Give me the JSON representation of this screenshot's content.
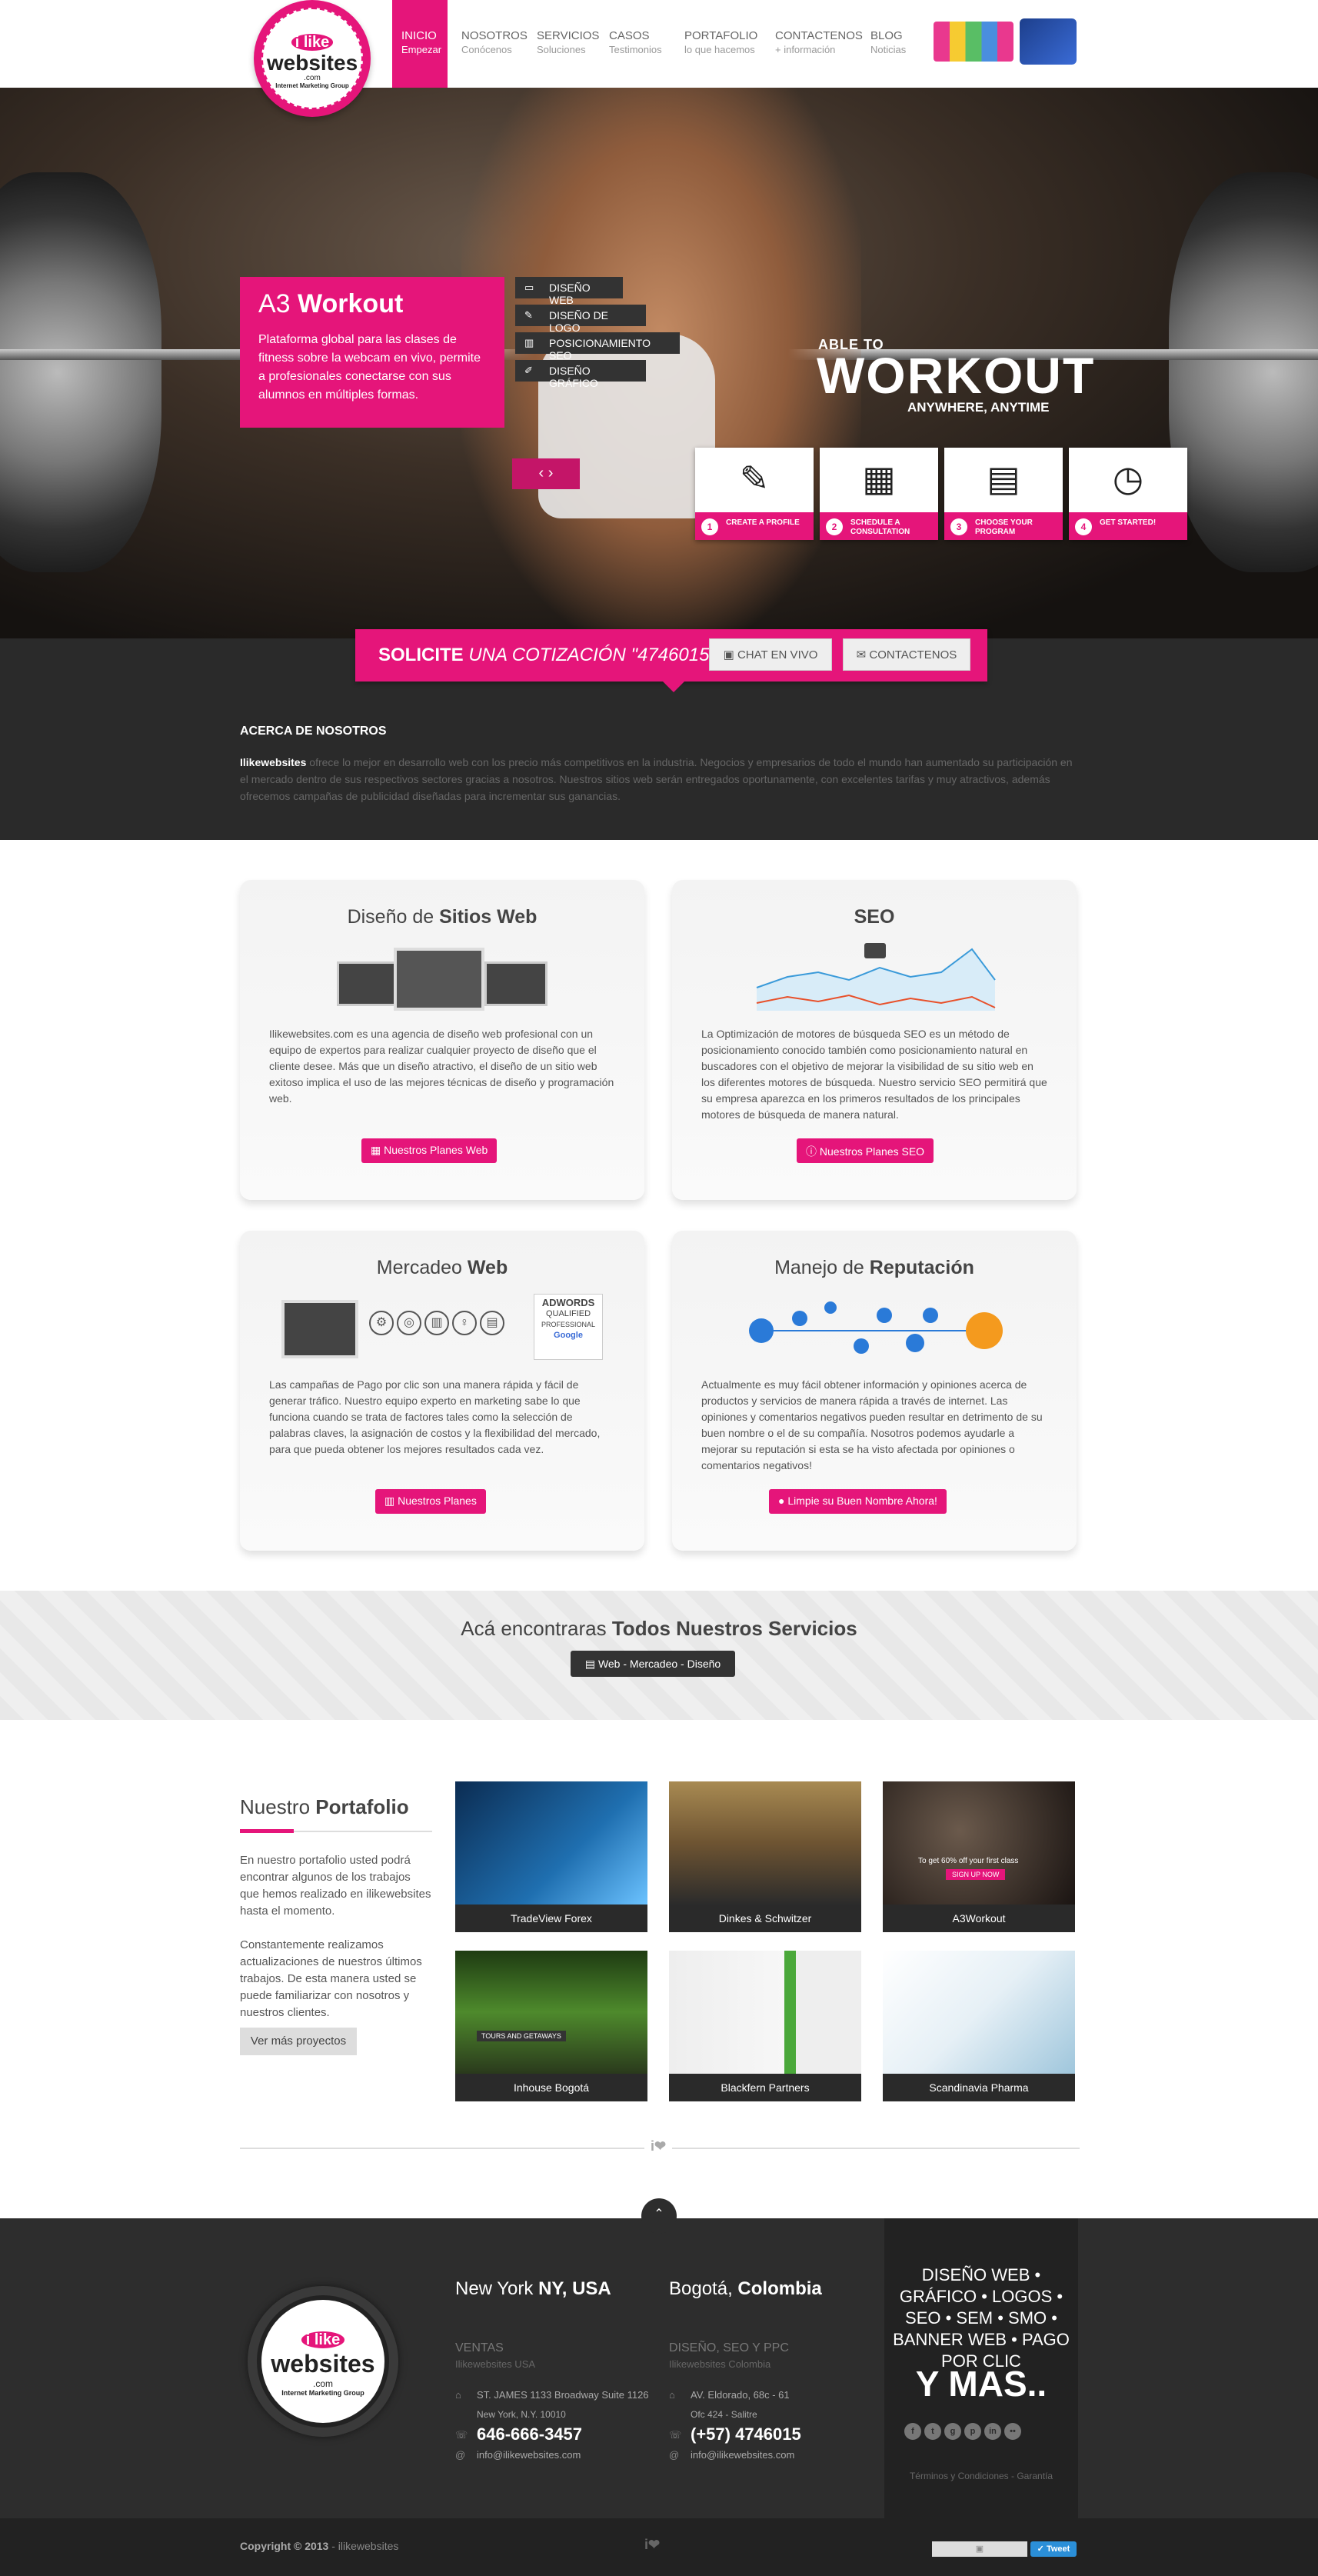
{
  "brand": {
    "logo_top": "i like",
    "logo_main": "websites",
    "logo_com": ".com",
    "logo_tag": "Internet Marketing Group",
    "accent": "#e5157a"
  },
  "nav": [
    {
      "label": "INICIO",
      "sub": "Empezar"
    },
    {
      "label": "NOSOTROS",
      "sub": "Conócenos"
    },
    {
      "label": "SERVICIOS",
      "sub": "Soluciones"
    },
    {
      "label": "CASOS",
      "sub": "Testimonios"
    },
    {
      "label": "PORTAFOLIO",
      "sub": "lo que hacemos"
    },
    {
      "label": "CONTACTENOS",
      "sub": "+ información"
    },
    {
      "label": "BLOG",
      "sub": "Noticias"
    }
  ],
  "hero": {
    "project_prefix": "A3",
    "project_name": "Workout",
    "project_desc": "Plataforma global para las clases de fitness sobre la webcam en vivo, permite a profesionales conectarse con sus alumnos en múltiples formas.",
    "tags": [
      "DISEÑO WEB",
      "DISEÑO DE LOGO",
      "POSICIONAMIENTO SEO",
      "DISEÑO GRÁFICO"
    ],
    "wo_line1": "ABLE TO",
    "wo_line2": "WORKOUT",
    "wo_line3": "ANYWHERE, ANYTIME",
    "steps": [
      {
        "num": "1",
        "label": "CREATE A PROFILE",
        "icon": "edit-icon"
      },
      {
        "num": "2",
        "label": "SCHEDULE A CONSULTATION",
        "icon": "calendar-icon"
      },
      {
        "num": "3",
        "label": "CHOOSE YOUR PROGRAM",
        "icon": "clipboard-icon"
      },
      {
        "num": "4",
        "label": "GET STARTED!",
        "icon": "stopwatch-icon"
      }
    ]
  },
  "quote": {
    "solicite": "SOLICITE",
    "rest": "UNA COTIZACIÓN \"4746015\"",
    "chat": "CHAT EN VIVO",
    "contact": "CONTACTENOS"
  },
  "about": {
    "title": "ACERCA DE NOSOTROS",
    "brand": "Ilikewebsites",
    "body": " ofrece lo mejor en desarrollo web con los precio más competitivos en la industria. Negocios y empresarios de todo el mundo han aumentado su participación en el mercado dentro de sus respectivos sectores gracias a nosotros. Nuestros sitios web serán entregados oportunamente, con excelentes tarifas y muy atractivos, además ofrecemos campañas de publicidad diseñadas para incrementar sus ganancias."
  },
  "services": [
    {
      "t1": "Diseño de",
      "t2": "Sitios Web",
      "body": "Ilikewebsites.com es una agencia de diseño web profesional con un equipo de expertos para realizar cualquier proyecto de diseño que el cliente desee. Más que un diseño atractivo, el diseño de un sitio web exitoso implica el uso de las mejores técnicas de diseño y programación web.",
      "btn": "Nuestros Planes Web"
    },
    {
      "t1": "",
      "t2": "SEO",
      "body": "La Optimización de motores de búsqueda SEO es un método de posicionamiento conocido también como posicionamiento natural en buscadores con el objetivo de mejorar la visibilidad de su sitio web en los diferentes motores de búsqueda. Nuestro servicio SEO permitirá que su empresa aparezca en los primeros resultados de los principales motores de búsqueda de manera natural.",
      "btn": "Nuestros Planes SEO"
    },
    {
      "t1": "Mercadeo",
      "t2": "Web",
      "body": "Las campañas de Pago por clic son una manera rápida y fácil de generar tráfico. Nuestro equipo experto en marketing sabe lo que funciona cuando se trata de factores tales como la selección de palabras claves, la asignación de costos y la flexibilidad del mercado, para que pueda obtener los mejores resultados cada vez.",
      "btn": "Nuestros Planes",
      "badge1": "ADWORDS",
      "badge2": "QUALIFIED",
      "badge3": "PROFESSIONAL",
      "badge4": "Google"
    },
    {
      "t1": "Manejo de",
      "t2": "Reputación",
      "body": "Actualmente es muy fácil obtener información y opiniones acerca de productos y servicios de manera rápida a través de internet. Las opiniones y comentarios negativos pueden resultar en detrimento de su buen nombre o el de su compañía. Nosotros podemos ayudarle a mejorar su reputación si esta se ha visto afectada por opiniones o comentarios negativos!",
      "btn": "Limpie su Buen Nombre Ahora!"
    }
  ],
  "band": {
    "t1": "Acá encontraras",
    "t2": "Todos Nuestros Servicios",
    "btn": "Web - Mercadeo - Diseño"
  },
  "portfolio": {
    "t1": "Nuestro",
    "t2": "Portafolio",
    "p1": "En nuestro portafolio usted podrá encontrar algunos de los trabajos que hemos realizado en ilikewebsites hasta el momento.",
    "p2": "Constantemente realizamos actualizaciones de nuestros últimos trabajos. De esta manera usted se puede familiarizar con nosotros y nuestros clientes.",
    "more": "Ver más proyectos",
    "items": [
      "TradeView Forex",
      "Dinkes & Schwitzer",
      "A3Workout",
      "Inhouse Bogotá",
      "Blackfern Partners",
      "Scandinavia Pharma"
    ],
    "a3_promo": "To get 60% off your first class",
    "a3_btn": "SIGN UP NOW",
    "inhouse_tag": "TOURS AND GETAWAYS"
  },
  "footer": {
    "ny_city": "New York",
    "ny_state": "NY, USA",
    "bog_city": "Bogotá,",
    "bog_country": "Colombia",
    "ny_label": "VENTAS",
    "ny_sub": "Ilikewebsites USA",
    "ny_addr1": "ST. JAMES 1133 Broadway Suite 1126",
    "ny_addr2": "New York, N.Y. 10010",
    "ny_phone": "646-666-3457",
    "ny_mail": "info@ilikewebsites.com",
    "bog_label": "DISEÑO, SEO Y PPC",
    "bog_sub": "Ilikewebsites Colombia",
    "bog_addr1": "AV. Eldorado, 68c - 61",
    "bog_addr2": "Ofc 424 - Salitre",
    "bog_phone": "(+57) 4746015",
    "bog_mail": "info@ilikewebsites.com",
    "box": "DISEÑO WEB • GRÁFICO • LOGOS • SEO • SEM • SMO • BANNER WEB • PAGO POR CLIC",
    "mas": "Y MAS..",
    "terms": "Términos y Condiciones - Garantía",
    "copy_b": "Copyright © 2013",
    "copy": " - ilikewebsites",
    "tweet": "Tweet"
  }
}
